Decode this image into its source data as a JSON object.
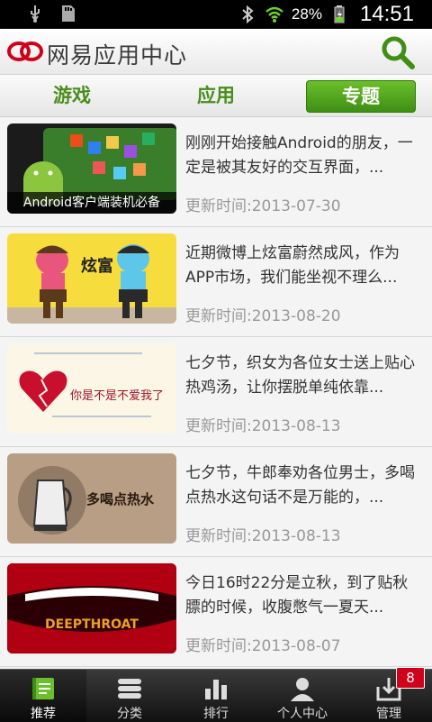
{
  "status_bar": {
    "battery": "28%",
    "time": "14:51"
  },
  "header": {
    "title": "网易应用中心"
  },
  "tabs": [
    {
      "label": "游戏",
      "active": false
    },
    {
      "label": "应用",
      "active": false
    },
    {
      "label": "专题",
      "active": true
    }
  ],
  "items": [
    {
      "title": "刚刚开始接触Android的朋友，一定是被其友好的交互界面，...",
      "date": "更新时间:2013-07-30",
      "thumb_caption": "Android客户端装机必备"
    },
    {
      "title": "近期微博上炫富蔚然成风，作为APP市场，我们能坐视不理么...",
      "date": "更新时间:2013-08-20",
      "thumb_caption": ""
    },
    {
      "title": "七夕节，织女为各位女士送上贴心热鸡汤，让你摆脱单纯依靠...",
      "date": "更新时间:2013-08-13",
      "thumb_caption": ""
    },
    {
      "title": "七夕节，牛郎奉劝各位男士，多喝点热水这句话不是万能的，...",
      "date": "更新时间:2013-08-13",
      "thumb_caption": ""
    },
    {
      "title": "今日16时22分是立秋，到了贴秋膘的时候，收腹憋气一夏天...",
      "date": "更新时间:2013-08-07",
      "thumb_caption": ""
    }
  ],
  "thumb_text": {
    "item2": "炫富",
    "item3_heart": "你是不是不爱我了",
    "item4": "多喝点热水",
    "item5": "DEEPTHROAT"
  },
  "nav": [
    {
      "label": "推荐",
      "active": true
    },
    {
      "label": "分类",
      "active": false
    },
    {
      "label": "排行",
      "active": false
    },
    {
      "label": "个人中心",
      "active": false
    },
    {
      "label": "管理",
      "active": false
    }
  ],
  "badge_count": "8",
  "colors": {
    "accent": "#4a8d1c",
    "tab_active": "#3e8f14",
    "badge": "#d0021b"
  }
}
